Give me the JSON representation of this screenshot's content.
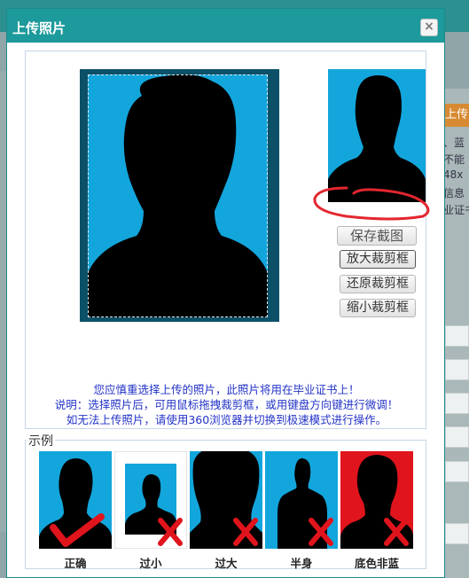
{
  "background": {
    "side_heading": "上传",
    "side_lines": [
      "、蓝",
      "不能",
      "48x",
      "信息",
      "业证书"
    ]
  },
  "dialog": {
    "title": "上传照片",
    "close_label": "×"
  },
  "crop": {
    "save_button": "保存截图",
    "zoom_in_button": "放大裁剪框",
    "reset_button": "还原裁剪框",
    "zoom_out_button": "缩小裁剪框"
  },
  "notices": [
    "您应慎重选择上传的照片，此照片将用在毕业证书上！",
    "说明：选择照片后，可用鼠标拖拽裁剪框，或用键盘方向键进行微调！",
    "如无法上传照片，请使用360浏览器并切换到极速模式进行操作。"
  ],
  "examples": {
    "legend": "示例",
    "items": [
      {
        "label": "正确",
        "mark": "check",
        "bg": "#13a6dc"
      },
      {
        "label": "过小",
        "mark": "cross",
        "bg": "#13a6dc"
      },
      {
        "label": "过大",
        "mark": "cross",
        "bg": "#13a6dc"
      },
      {
        "label": "半身",
        "mark": "cross",
        "bg": "#13a6dc"
      },
      {
        "label": "底色非蓝",
        "mark": "cross",
        "bg": "#e0141c"
      }
    ]
  },
  "colors": {
    "title_bar": "#1d9a9b",
    "photo_blue": "#13a6dc",
    "notice_text": "#2333c7",
    "mark_red": "#e0141c"
  }
}
